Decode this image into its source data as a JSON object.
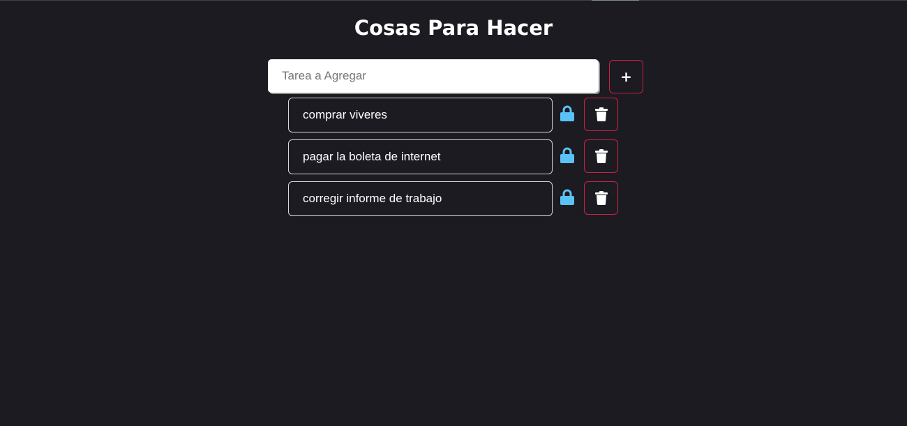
{
  "header": {
    "title": "Cosas Para Hacer"
  },
  "new_task": {
    "value": "",
    "placeholder": "Tarea a Agregar",
    "add_label": "+"
  },
  "tasks": [
    {
      "text": "comprar viveres",
      "lock_icon": "lock-icon",
      "delete_icon": "trash-icon"
    },
    {
      "text": "pagar la boleta de internet",
      "lock_icon": "lock-icon",
      "delete_icon": "trash-icon"
    },
    {
      "text": "corregir informe de trabajo",
      "lock_icon": "lock-icon",
      "delete_icon": "trash-icon"
    }
  ],
  "colors": {
    "background": "#1c1b22",
    "accent_border": "#d0203e",
    "lock_icon": "#5bc2f5",
    "task_border": "#d9d9d9",
    "text": "#ffffff"
  }
}
